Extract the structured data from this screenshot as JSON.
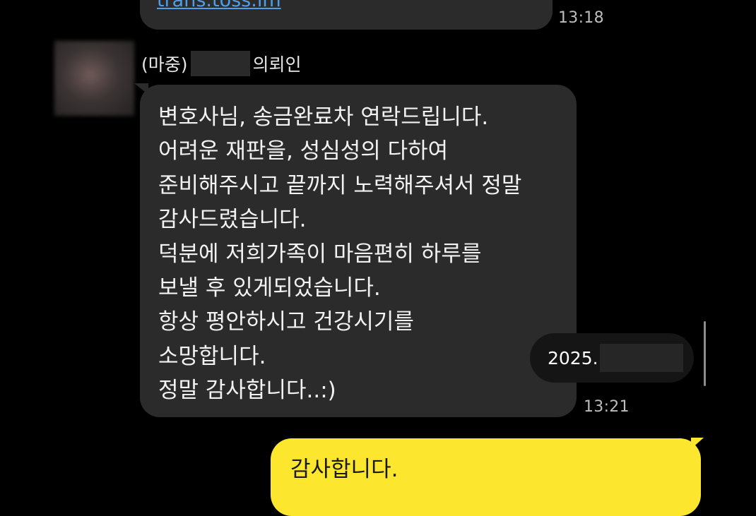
{
  "chat": {
    "previous_message": {
      "link_text": "trans.toss.im",
      "time": "13:18"
    },
    "sender": {
      "prefix": "(마중)",
      "suffix": "의뢰인"
    },
    "message": {
      "lines": [
        "변호사님, 송금완료차 연락드립니다.",
        "어려운 재판을, 성심성의 다하여",
        "준비해주시고 끝까지 노력해주셔서 정말",
        "감사드렸습니다.",
        "덕분에 저희가족이 마음편히 하루를",
        "보낼 후 있게되었습니다.",
        "항상 평안하시고 건강시기를",
        "소망합니다.",
        "정말 감사합니다..:)"
      ],
      "time": "13:21"
    },
    "date_indicator": "2025.",
    "my_message": {
      "text": "감사합니다."
    }
  },
  "colors": {
    "background": "#000000",
    "incoming_bubble": "#2b2b2b",
    "outgoing_bubble": "#fde72e",
    "link": "#4f9fe8"
  }
}
